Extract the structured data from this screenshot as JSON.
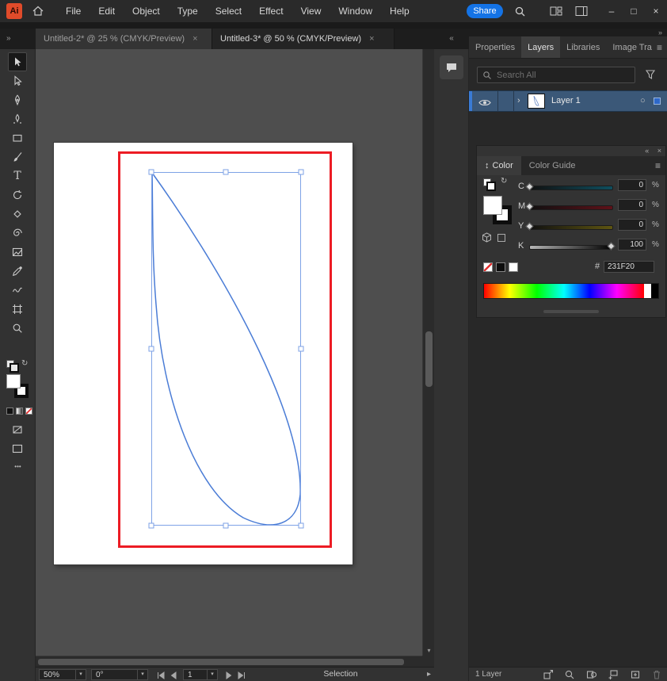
{
  "app": {
    "logo": "Ai"
  },
  "icons": {
    "close": "×",
    "chevron": "▾",
    "chevrons_right": "»",
    "chevrons_left": "«",
    "minimize": "–",
    "maximize": "□",
    "hamburger": "≡",
    "ellipsis": "•••",
    "swap": "↻",
    "target": "○",
    "updown": "↕",
    "chevron_right": "›",
    "play": "▸",
    "type_tool": "T"
  },
  "menubar": {
    "items": [
      "File",
      "Edit",
      "Object",
      "Type",
      "Select",
      "Effect",
      "View",
      "Window",
      "Help"
    ],
    "share": "Share"
  },
  "doc_tabs": [
    {
      "label": "Untitled-2* @ 25 % (CMYK/Preview)"
    },
    {
      "label": "Untitled-3* @ 50 % (CMYK/Preview)"
    }
  ],
  "toolbar": {
    "tools": [
      "selection",
      "direct-selection",
      "pen",
      "curvature",
      "rectangle",
      "paintbrush",
      "type",
      "rotate",
      "eraser",
      "rotate-view",
      "frame",
      "eyedropper",
      "shaper",
      "artboard",
      "zoom"
    ]
  },
  "dock": {
    "tabs": [
      "Properties",
      "Layers",
      "Libraries",
      "Image Tra"
    ]
  },
  "layers_panel": {
    "search_placeholder": "Search All",
    "layer_name": "Layer 1",
    "footer": "1 Layer"
  },
  "color_panel": {
    "tab_color": "Color",
    "tab_guide": "Color Guide",
    "channels": [
      {
        "label": "C",
        "value": "0",
        "unit": "%"
      },
      {
        "label": "M",
        "value": "0",
        "unit": "%"
      },
      {
        "label": "Y",
        "value": "0",
        "unit": "%"
      },
      {
        "label": "K",
        "value": "100",
        "unit": "%"
      }
    ],
    "hex_prefix": "#",
    "hex": "231F20"
  },
  "statusbar": {
    "zoom": "50%",
    "rotation": "0°",
    "artboard": "1",
    "status": "Selection"
  },
  "artwork": {
    "red": "#ec1c24",
    "blue": "#4a7cd6",
    "selection": "#7ea2e6"
  }
}
